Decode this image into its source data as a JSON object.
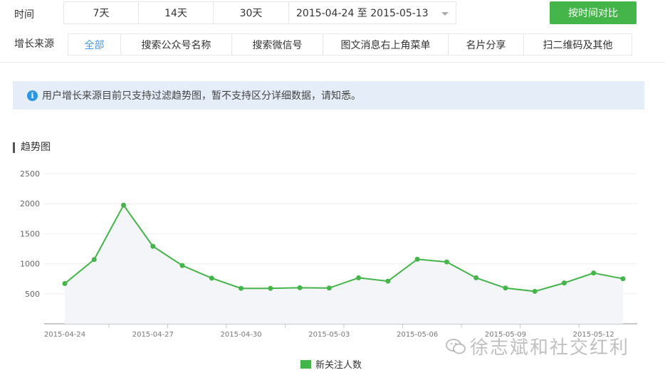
{
  "time_filter": {
    "label": "时间",
    "options": [
      "7天",
      "14天",
      "30天"
    ],
    "date_range": "2015-04-24 至 2015-05-13",
    "compare_button": "按时间对比"
  },
  "source_filter": {
    "label": "增长来源",
    "options": [
      "全部",
      "搜索公众号名称",
      "搜索微信号",
      "图文消息右上角菜单",
      "名片分享",
      "扫二维码及其他"
    ],
    "active_index": 0
  },
  "notice": {
    "icon": "info-icon",
    "text": "用户增长来源目前只支持过滤趋势图，暂不支持区分详细数据，请知悉。"
  },
  "section_title": "趋势图",
  "watermark": "徐志斌和社交红利",
  "colors": {
    "accent": "#44b549",
    "link": "#459ae9",
    "notice_bg": "#e5eef8"
  },
  "chart_data": {
    "type": "line",
    "title": "",
    "xlabel": "",
    "ylabel": "",
    "ylim": [
      0,
      2500
    ],
    "yticks": [
      500,
      1000,
      1500,
      2000,
      2500
    ],
    "x": [
      "2015-04-24",
      "2015-04-25",
      "2015-04-26",
      "2015-04-27",
      "2015-04-28",
      "2015-04-29",
      "2015-04-30",
      "2015-05-01",
      "2015-05-02",
      "2015-05-03",
      "2015-05-04",
      "2015-05-05",
      "2015-05-06",
      "2015-05-07",
      "2015-05-08",
      "2015-05-09",
      "2015-05-10",
      "2015-05-11",
      "2015-05-12",
      "2015-05-13"
    ],
    "x_tick_labels": [
      "2015-04-24",
      "2015-04-27",
      "2015-04-30",
      "2015-05-03",
      "2015-05-06",
      "2015-05-09",
      "2015-05-12"
    ],
    "series": [
      {
        "name": "新关注人数",
        "color": "#44b549",
        "values": [
          670,
          1070,
          1975,
          1290,
          970,
          760,
          590,
          590,
          600,
          595,
          765,
          710,
          1075,
          1030,
          765,
          595,
          540,
          680,
          845,
          750
        ]
      }
    ],
    "grid": true,
    "legend": "bottom-center"
  }
}
